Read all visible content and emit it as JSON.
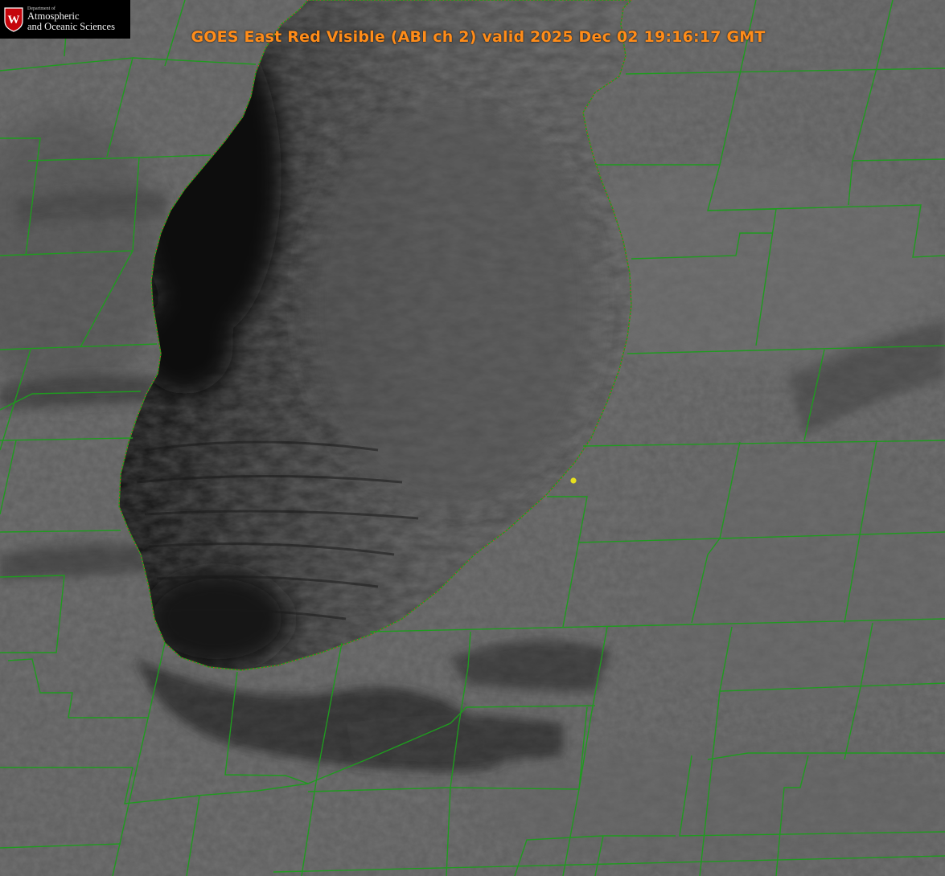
{
  "title": "GOES East Red Visible (ABI ch 2) valid 2025 Dec 02 19:16:17 GMT",
  "logo": {
    "crest_letter": "W",
    "department": "Department of",
    "line1": "Atmospheric",
    "line2": "and Oceanic Sciences"
  },
  "map": {
    "imagery": "satellite-visible-grayscale",
    "county_line_color": "#1f9b1f",
    "shoreline_color": "#e0303a",
    "title_color": "#ff8c19",
    "marker_color": "#e6e01e",
    "lake": "lake-michigan-southern-basin"
  }
}
